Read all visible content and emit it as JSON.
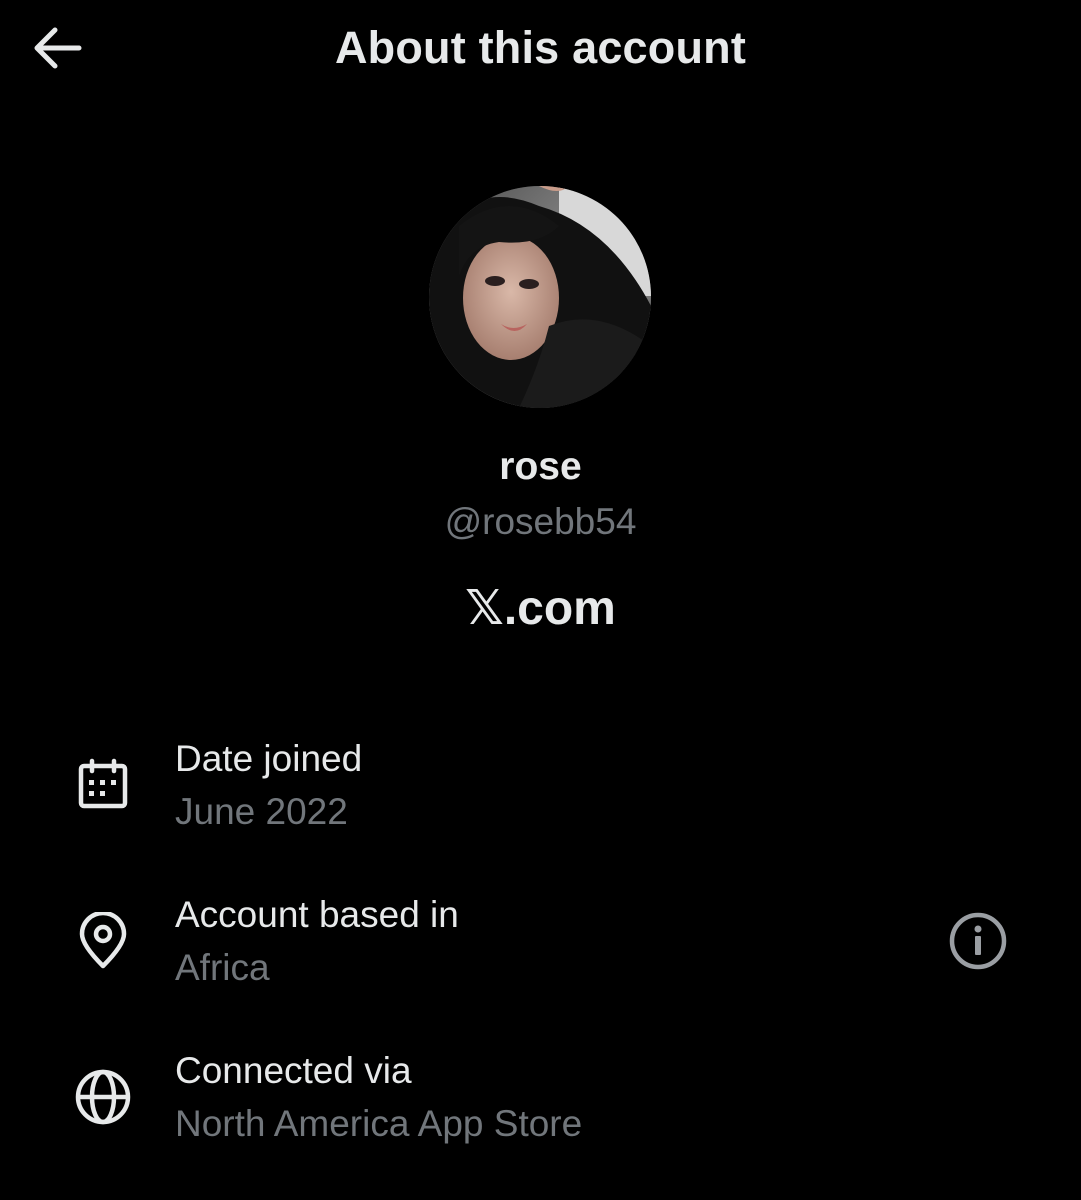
{
  "header": {
    "title": "About this account",
    "back_icon": "arrow-left-icon"
  },
  "profile": {
    "display_name": "rose",
    "handle": "@rosebb54",
    "domain": "𝕏.com",
    "avatar": "profile-photo"
  },
  "rows": [
    {
      "icon": "calendar-icon",
      "label": "Date joined",
      "value": "June 2022"
    },
    {
      "icon": "location-pin-icon",
      "label": "Account based in",
      "value": "Africa",
      "trailing_icon": "info-icon"
    },
    {
      "icon": "globe-icon",
      "label": "Connected via",
      "value": "North America App Store"
    }
  ],
  "colors": {
    "background": "#000000",
    "primary_text": "#e7e9ea",
    "secondary_text": "#71767b"
  }
}
